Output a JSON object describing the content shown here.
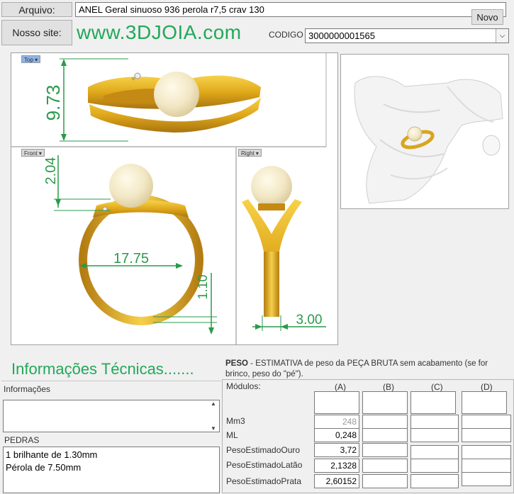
{
  "header": {
    "arquivo_label": "Arquivo:",
    "arquivo_value": "ANEL Geral sinuoso 936 perola r7,5 crav 130",
    "novo_label": "Novo",
    "site_label": "Nosso site:",
    "site_url": "www.3DJOIA.com",
    "codigo_label": "CODIGO",
    "codigo_value": "3000000001565"
  },
  "drawing": {
    "views": {
      "top": "Top",
      "front": "Front",
      "right": "Right"
    },
    "dims": {
      "height": "9.73",
      "top_gap": "2.04",
      "width": "17.75",
      "thickness": "1.10",
      "band": "3.00"
    }
  },
  "info": {
    "title": "Informações Técnicas.......",
    "informacoes_label": "Informações",
    "pedras_label": "PEDRAS",
    "pedras_lines": [
      "1 brilhante de 1.30mm",
      "Pérola de 7.50mm"
    ]
  },
  "peso": {
    "title": "PESO",
    "description": " -  ESTIMATIVA de peso da PEÇA BRUTA sem acabamento (se for brinco, peso do \"pé\").",
    "modulos_label": "Módulos:",
    "columns": [
      "(A)",
      "(B)",
      "(C)",
      "(D)"
    ],
    "rows": [
      {
        "label": "Mm3",
        "a": "248"
      },
      {
        "label": "ML",
        "a": "0,248"
      },
      {
        "label": "PesoEstimadoOuro",
        "a": "3,72"
      },
      {
        "label": "PesoEstimadoLatão",
        "a": "2,1328"
      },
      {
        "label": "PesoEstimadoPrata",
        "a": "2,60152"
      }
    ]
  }
}
